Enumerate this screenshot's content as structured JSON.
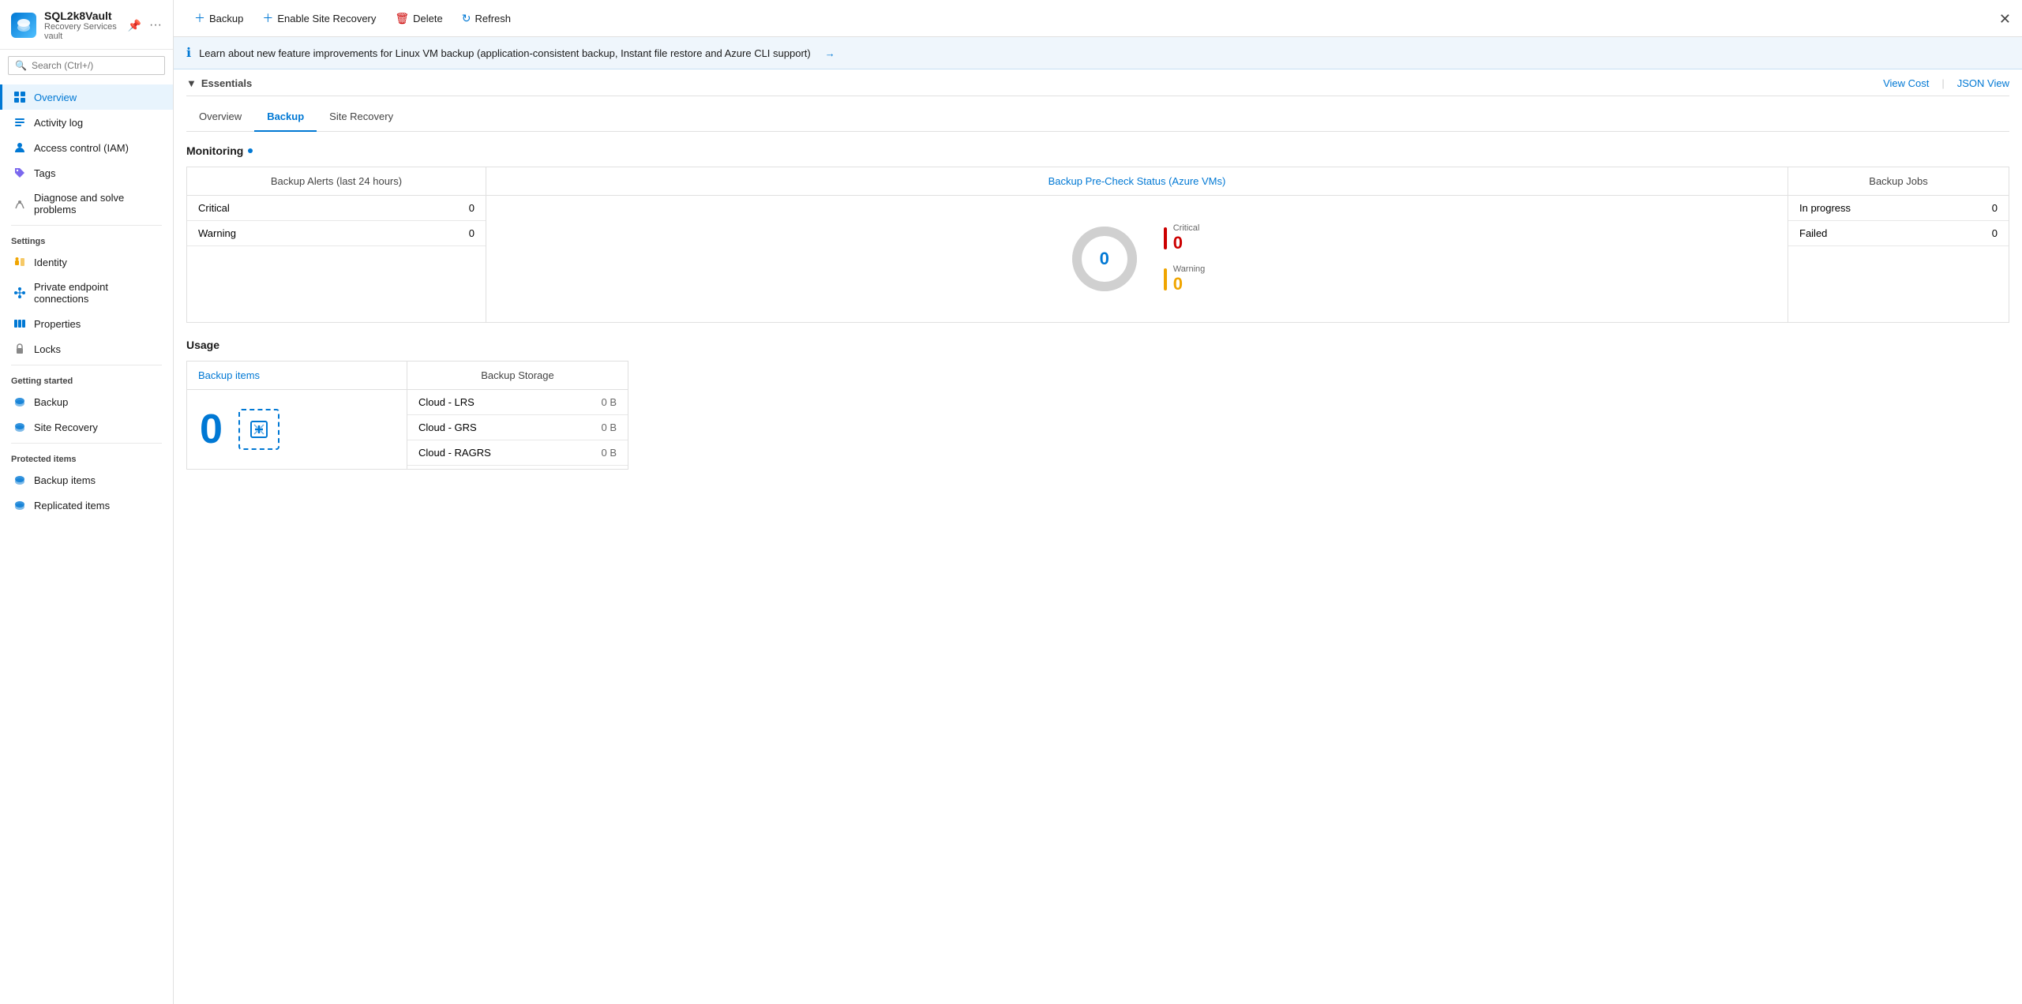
{
  "window": {
    "title": "SQL2k8Vault",
    "subtitle": "Recovery Services vault"
  },
  "sidebar": {
    "search_placeholder": "Search (Ctrl+/)",
    "nav_items": [
      {
        "id": "overview",
        "label": "Overview",
        "icon": "grid",
        "active": true
      },
      {
        "id": "activity-log",
        "label": "Activity log",
        "icon": "list"
      },
      {
        "id": "access-control",
        "label": "Access control (IAM)",
        "icon": "person"
      },
      {
        "id": "tags",
        "label": "Tags",
        "icon": "tag"
      },
      {
        "id": "diagnose",
        "label": "Diagnose and solve problems",
        "icon": "wrench"
      }
    ],
    "settings_label": "Settings",
    "settings_items": [
      {
        "id": "identity",
        "label": "Identity",
        "icon": "key"
      },
      {
        "id": "private-endpoint",
        "label": "Private endpoint connections",
        "icon": "link"
      },
      {
        "id": "properties",
        "label": "Properties",
        "icon": "bars"
      },
      {
        "id": "locks",
        "label": "Locks",
        "icon": "lock"
      }
    ],
    "getting_started_label": "Getting started",
    "getting_started_items": [
      {
        "id": "backup",
        "label": "Backup",
        "icon": "cloud"
      },
      {
        "id": "site-recovery",
        "label": "Site Recovery",
        "icon": "cloud"
      }
    ],
    "protected_items_label": "Protected items",
    "protected_items": [
      {
        "id": "backup-items",
        "label": "Backup items",
        "icon": "cloud"
      },
      {
        "id": "replicated-items",
        "label": "Replicated items",
        "icon": "cloud"
      }
    ]
  },
  "toolbar": {
    "backup_label": "Backup",
    "enable_site_recovery_label": "Enable Site Recovery",
    "delete_label": "Delete",
    "refresh_label": "Refresh"
  },
  "info_banner": {
    "text": "Learn about new feature improvements for Linux VM backup (application-consistent backup, Instant file restore and Azure CLI support)",
    "arrow": "→"
  },
  "essentials": {
    "title": "Essentials",
    "view_cost_label": "View Cost",
    "json_view_label": "JSON View"
  },
  "tabs": [
    {
      "id": "tab-overview",
      "label": "Overview",
      "active": false
    },
    {
      "id": "tab-backup",
      "label": "Backup",
      "active": true
    },
    {
      "id": "tab-site-recovery",
      "label": "Site Recovery",
      "active": false
    }
  ],
  "monitoring": {
    "section_title": "Monitoring",
    "backup_alerts": {
      "title": "Backup Alerts (last 24 hours)",
      "rows": [
        {
          "label": "Critical",
          "value": "0"
        },
        {
          "label": "Warning",
          "value": "0"
        }
      ]
    },
    "precheck": {
      "title": "Backup Pre-Check Status (Azure VMs)",
      "donut_value": "0",
      "legend": [
        {
          "type": "critical",
          "label": "Critical",
          "value": "0"
        },
        {
          "type": "warning",
          "label": "Warning",
          "value": "0"
        }
      ]
    },
    "backup_jobs": {
      "title": "Backup Jobs",
      "rows": [
        {
          "label": "In progress",
          "value": "0"
        },
        {
          "label": "Failed",
          "value": "0"
        }
      ]
    }
  },
  "usage": {
    "section_title": "Usage",
    "backup_items": {
      "title": "Backup items",
      "value": "0"
    },
    "backup_storage": {
      "title": "Backup Storage",
      "rows": [
        {
          "label": "Cloud - LRS",
          "value": "0 B"
        },
        {
          "label": "Cloud - GRS",
          "value": "0 B"
        },
        {
          "label": "Cloud - RAGRS",
          "value": "0 B"
        }
      ]
    }
  },
  "colors": {
    "accent": "#0078d4",
    "critical": "#c00000",
    "warning": "#f0a500",
    "donut_empty": "#d0d0d0"
  }
}
